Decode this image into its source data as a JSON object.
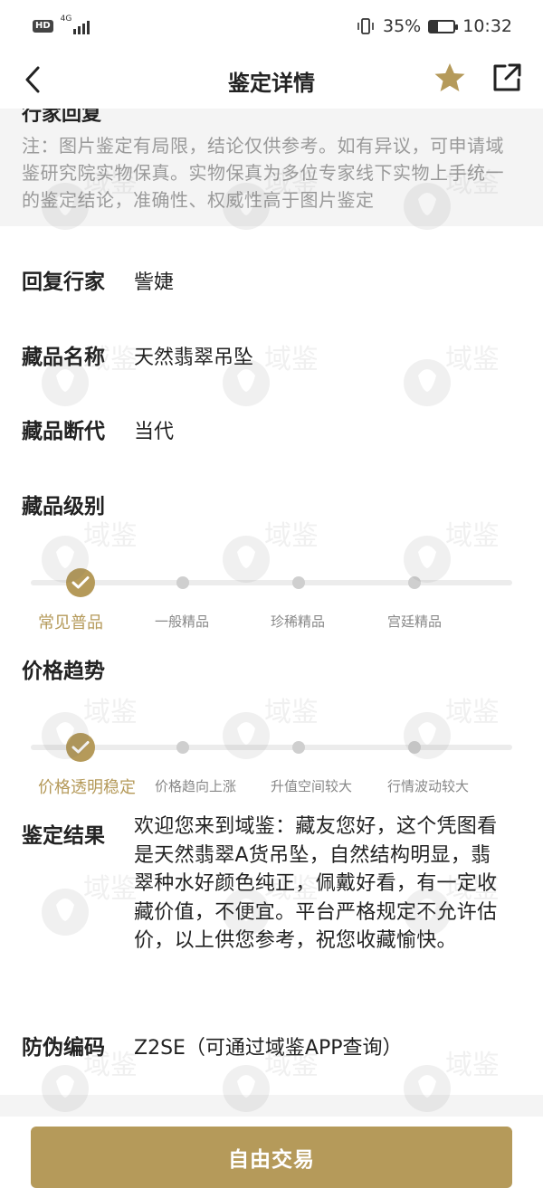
{
  "status_bar": {
    "hd": "HD",
    "network": "4G",
    "battery_percent": "35%",
    "battery_level": 0.35,
    "time": "10:32"
  },
  "nav": {
    "title": "鉴定详情"
  },
  "note": {
    "clipped_heading": "行家回复",
    "text": "注：图片鉴定有局限，结论仅供参考。如有异议，可申请域鉴研究院实物保真。实物保真为多位专家线下实物上手统一的鉴定结论，准确性、权威性高于图片鉴定"
  },
  "details": {
    "expert_label": "回复行家",
    "expert_value": "訾婕",
    "name_label": "藏品名称",
    "name_value": "天然翡翠吊坠",
    "era_label": "藏品断代",
    "era_value": "当代",
    "grade_label": "藏品级别",
    "price_label": "价格趋势",
    "result_label": "鉴定结果",
    "result_value": "欢迎您来到域鉴：藏友您好，这个凭图看是天然翡翠A货吊坠，自然结构明显，翡翠种水好颜色纯正，佩戴好看，有一定收藏价值，不便宜。平台严格规定不允许估价，以上供您参考，祝您收藏愉快。",
    "code_label": "防伪编码",
    "code_value": "Z2SE（可通过域鉴APP查询）"
  },
  "grade_steps": [
    "常见普品",
    "一般精品",
    "珍稀精品",
    "宫廷精品"
  ],
  "grade_selected_index": 0,
  "price_steps": [
    "价格透明稳定",
    "价格趋向上涨",
    "升值空间较大",
    "行情波动较大"
  ],
  "price_selected_index": 0,
  "action": {
    "trade_label": "自由交易"
  },
  "watermark_text": "域鉴",
  "colors": {
    "accent": "#b59a5a",
    "text": "#222222",
    "muted": "#9a9a9a",
    "section_bg": "#f4f4f4"
  }
}
